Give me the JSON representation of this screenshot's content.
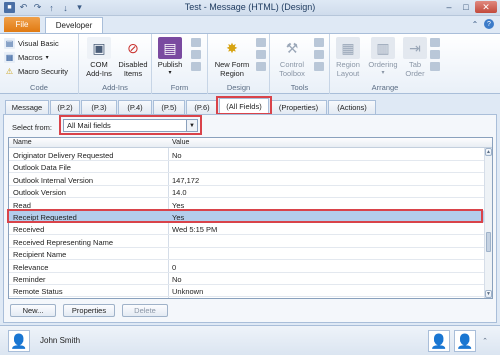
{
  "window": {
    "title": "Test - Message (HTML) (Design)"
  },
  "ribbon": {
    "tabs": [
      {
        "label": "File"
      },
      {
        "label": "Developer"
      }
    ],
    "code": {
      "label": "Code",
      "items": [
        {
          "label": "Visual Basic"
        },
        {
          "label": "Macros"
        },
        {
          "label": "Macro Security"
        }
      ]
    },
    "addins": {
      "label": "Add-Ins",
      "buttons": [
        {
          "label_line1": "COM",
          "label_line2": "Add-Ins"
        },
        {
          "label_line1": "Disabled",
          "label_line2": "Items"
        }
      ]
    },
    "form": {
      "label": "Form",
      "button": {
        "label": "Publish"
      }
    },
    "design": {
      "label": "Design",
      "button": {
        "label_line1": "New Form",
        "label_line2": "Region"
      }
    },
    "tools": {
      "label": "Tools",
      "button": {
        "label_line1": "Control",
        "label_line2": "Toolbox"
      }
    },
    "arrange": {
      "label": "Arrange",
      "buttons": [
        {
          "label_line1": "Region",
          "label_line2": "Layout"
        },
        {
          "label_line1": "Ordering",
          "label_line2": ""
        },
        {
          "label_line1": "Tab",
          "label_line2": "Order"
        }
      ]
    }
  },
  "form_tabs": [
    {
      "label": "Message"
    },
    {
      "label": "(P.2)"
    },
    {
      "label": "(P.3)"
    },
    {
      "label": "(P.4)"
    },
    {
      "label": "(P.5)"
    },
    {
      "label": "(P.6)"
    },
    {
      "label": "(All Fields)"
    },
    {
      "label": "(Properties)"
    },
    {
      "label": "(Actions)"
    }
  ],
  "select_from": {
    "label": "Select from:",
    "value": "All Mail fields"
  },
  "grid": {
    "columns": [
      "Name",
      "Value"
    ],
    "rows": [
      {
        "name": "Originator Delivery Requested",
        "value": "No"
      },
      {
        "name": "Outlook Data File",
        "value": ""
      },
      {
        "name": "Outlook Internal Version",
        "value": "147,172"
      },
      {
        "name": "Outlook Version",
        "value": "14.0"
      },
      {
        "name": "Read",
        "value": "Yes"
      },
      {
        "name": "Receipt Requested",
        "value": "Yes",
        "selected": true
      },
      {
        "name": "Received",
        "value": "Wed 5:15 PM"
      },
      {
        "name": "Received Representing Name",
        "value": ""
      },
      {
        "name": "Recipient Name",
        "value": ""
      },
      {
        "name": "Relevance",
        "value": "0"
      },
      {
        "name": "Reminder",
        "value": "No"
      },
      {
        "name": "Remote Status",
        "value": "Unknown"
      }
    ]
  },
  "buttons": {
    "new": "New...",
    "properties": "Properties",
    "delete": "Delete"
  },
  "people_pane": {
    "name": "John Smith"
  },
  "colors": {
    "highlight": "#d9434a",
    "selection": "#b3cdeb",
    "file_tab": "#e07a12"
  }
}
